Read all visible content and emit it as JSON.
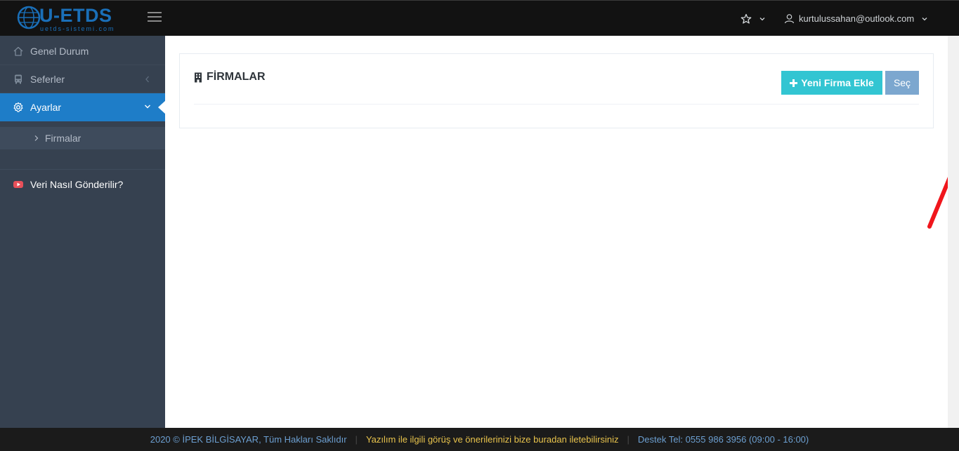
{
  "header": {
    "brand": "U-ETDS",
    "brand_sub": "uetds-sistemi.com",
    "user_email": "kurtulussahan@outlook.com"
  },
  "sidebar": {
    "items": [
      {
        "label": "Genel Durum",
        "icon": "home-icon"
      },
      {
        "label": "Seferler",
        "icon": "bus-icon"
      },
      {
        "label": "Ayarlar",
        "icon": "gear-icon",
        "active": true
      },
      {
        "label": "Veri Nasıl Gönderilir?",
        "icon": "youtube-icon"
      }
    ],
    "sub_items": [
      {
        "label": "Firmalar"
      }
    ]
  },
  "main": {
    "title": "FİRMALAR",
    "add_button": "Yeni Firma Ekle",
    "select_button": "Seç"
  },
  "footer": {
    "copyright": "2020 © İPEK BİLGİSAYAR, Tüm Hakları Saklıdır",
    "feedback": "Yazılım ile ilgili görüş ve önerilerinizi bize buradan iletebilirsiniz",
    "support": "Destek Tel: 0555 986 3956 (09:00 - 16:00)"
  },
  "colors": {
    "accent": "#1e7dc8",
    "add_button": "#32c5d2",
    "select_button": "#7ca7cf",
    "sidebar": "#364150",
    "annotation_arrow": "#f0161c"
  }
}
